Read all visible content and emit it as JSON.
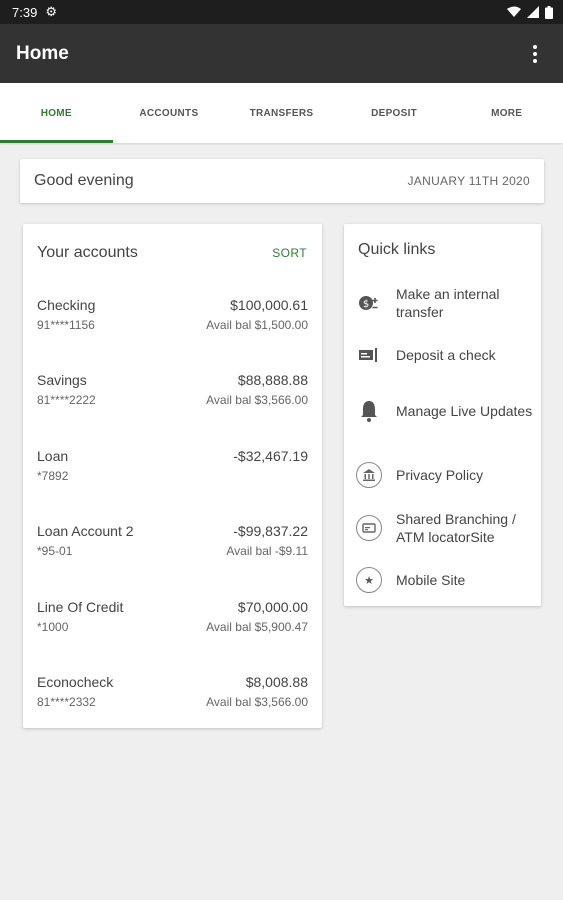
{
  "status": {
    "time": "7:39",
    "settings_icon": "gear-icon",
    "wifi_icon": "wifi-icon",
    "signal_icon": "signal-icon",
    "battery_icon": "battery-icon"
  },
  "appbar": {
    "title": "Home",
    "menu_icon": "more-vert-icon"
  },
  "tabs": [
    {
      "label": "HOME"
    },
    {
      "label": "ACCOUNTS"
    },
    {
      "label": "TRANSFERS"
    },
    {
      "label": "DEPOSIT"
    },
    {
      "label": "MORE"
    }
  ],
  "greeting": {
    "text": "Good evening",
    "date": "JANUARY 11TH 2020"
  },
  "accounts": {
    "title": "Your accounts",
    "sort_label": "SORT",
    "items": [
      {
        "name": "Checking",
        "number": "91****1156",
        "amount": "$100,000.61",
        "avail": "Avail bal $1,500.00"
      },
      {
        "name": "Savings",
        "number": "81****2222",
        "amount": "$88,888.88",
        "avail": "Avail bal $3,566.00"
      },
      {
        "name": "Loan",
        "number": "*7892",
        "amount": "-$32,467.19",
        "avail": ""
      },
      {
        "name": "Loan Account 2",
        "number": "*95-01",
        "amount": "-$99,837.22",
        "avail": "Avail bal -$9.11"
      },
      {
        "name": "Line Of Credit",
        "number": "*1000",
        "amount": "$70,000.00",
        "avail": "Avail bal $5,900.47"
      },
      {
        "name": "Econocheck",
        "number": "81****2332",
        "amount": "$8,008.88",
        "avail": "Avail bal $3,566.00"
      }
    ]
  },
  "quick_links": {
    "title": "Quick links",
    "items": [
      {
        "label": "Make an internal transfer",
        "icon": "transfer-icon"
      },
      {
        "label": "Deposit a check",
        "icon": "deposit-check-icon"
      },
      {
        "label": "Manage Live Updates",
        "icon": "bell-icon"
      },
      {
        "label": "Privacy Policy",
        "icon": "bank-icon"
      },
      {
        "label": "Shared Branching / ATM locatorSite",
        "icon": "card-icon"
      },
      {
        "label": "Mobile Site",
        "icon": "star-icon"
      }
    ]
  },
  "colors": {
    "accent": "#2e7d32",
    "appbar": "#333333",
    "statusbar": "#1e1e1e",
    "background": "#efefef"
  }
}
